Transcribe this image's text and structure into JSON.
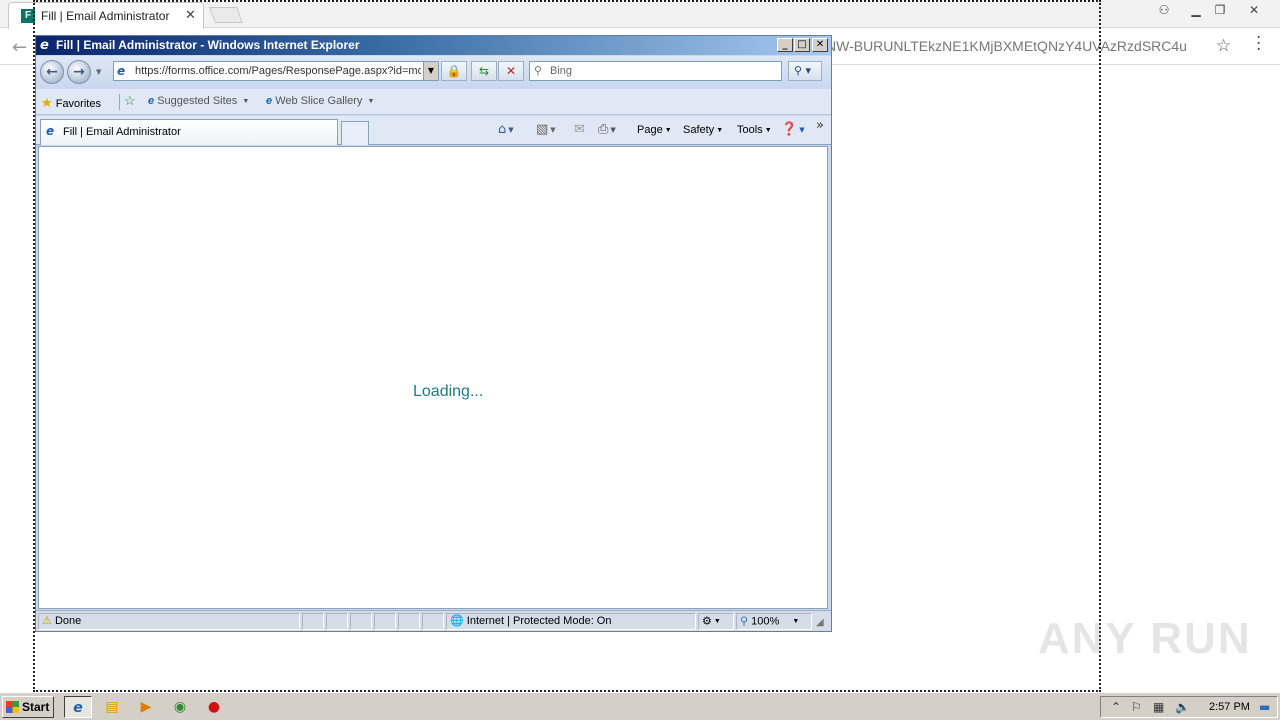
{
  "chrome": {
    "tab_title": "Fill | Email Administrator",
    "tab_close": "✕",
    "url_visible": "NW-BURUNLTEkzNE1KMjBXMEtQNzY4UVAzRzdSRC4u"
  },
  "ie": {
    "window_title": "Fill | Email Administrator - Windows Internet Explorer",
    "address": "https://forms.office.com/Pages/ResponsePage.aspx?id=mc",
    "search_placeholder": "Bing",
    "favorites": {
      "label": "Favorites",
      "items": [
        "Suggested Sites",
        "Web Slice Gallery"
      ]
    },
    "tab_title": "Fill | Email Administrator",
    "commands": {
      "page": "Page",
      "safety": "Safety",
      "tools": "Tools"
    },
    "content": {
      "loading_text": "Loading..."
    },
    "status": {
      "text": "Done",
      "zone": "Internet | Protected Mode: On",
      "zoom": "100%"
    }
  },
  "taskbar": {
    "start_label": "Start",
    "clock": "2:57 PM"
  },
  "watermark": "ANY RUN",
  "colors": {
    "ie_title_gradient_start": "#0a246a",
    "loading_text": "#1f7a8c",
    "forms_brand": "#077568"
  }
}
